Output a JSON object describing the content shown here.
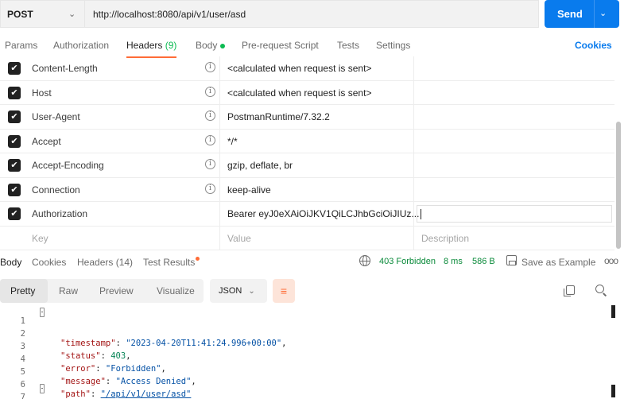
{
  "request": {
    "method": "POST",
    "url": "http://localhost:8080/api/v1/user/asd",
    "send_label": "Send"
  },
  "request_tabs": {
    "params": "Params",
    "authorization": "Authorization",
    "headers_label": "Headers",
    "headers_count": "(9)",
    "body": "Body",
    "pre_request": "Pre-request Script",
    "tests": "Tests",
    "settings": "Settings",
    "cookies": "Cookies"
  },
  "headers": [
    {
      "key": "Content-Length",
      "value": "<calculated when request is sent>",
      "checked": true
    },
    {
      "key": "Host",
      "value": "<calculated when request is sent>",
      "checked": true
    },
    {
      "key": "User-Agent",
      "value": "PostmanRuntime/7.32.2",
      "checked": true
    },
    {
      "key": "Accept",
      "value": "*/*",
      "checked": true
    },
    {
      "key": "Accept-Encoding",
      "value": "gzip, deflate, br",
      "checked": true
    },
    {
      "key": "Connection",
      "value": "keep-alive",
      "checked": true
    },
    {
      "key": "Authorization",
      "value": "Bearer eyJ0eXAiOiJKV1QiLCJhbGciOiJIUz...",
      "checked": true
    }
  ],
  "new_row": {
    "key_placeholder": "Key",
    "value_placeholder": "Value",
    "description_placeholder": "Description"
  },
  "response_tabs": {
    "body": "Body",
    "cookies": "Cookies",
    "headers": "Headers (14)",
    "test_results": "Test Results"
  },
  "response_status": {
    "status": "403 Forbidden",
    "time": "8 ms",
    "size": "586 B",
    "save_label": "Save as Example",
    "more": "ooo"
  },
  "viewer": {
    "tabs": [
      "Pretty",
      "Raw",
      "Preview",
      "Visualize"
    ],
    "format": "JSON"
  },
  "response_body": {
    "line_numbers": [
      "1",
      "2",
      "3",
      "4",
      "5",
      "6",
      "7"
    ],
    "open_brace": "{",
    "close_brace": "}",
    "fields": [
      {
        "key": "\"timestamp\"",
        "value": "\"2023-04-20T11:41:24.996+00:00\"",
        "type": "string",
        "trail": ","
      },
      {
        "key": "\"status\"",
        "value": "403",
        "type": "number",
        "trail": ","
      },
      {
        "key": "\"error\"",
        "value": "\"Forbidden\"",
        "type": "string",
        "trail": ","
      },
      {
        "key": "\"message\"",
        "value": "\"Access Denied\"",
        "type": "string",
        "trail": ","
      },
      {
        "key": "\"path\"",
        "value": "\"/api/v1/user/asd\"",
        "type": "link",
        "trail": ""
      }
    ]
  }
}
